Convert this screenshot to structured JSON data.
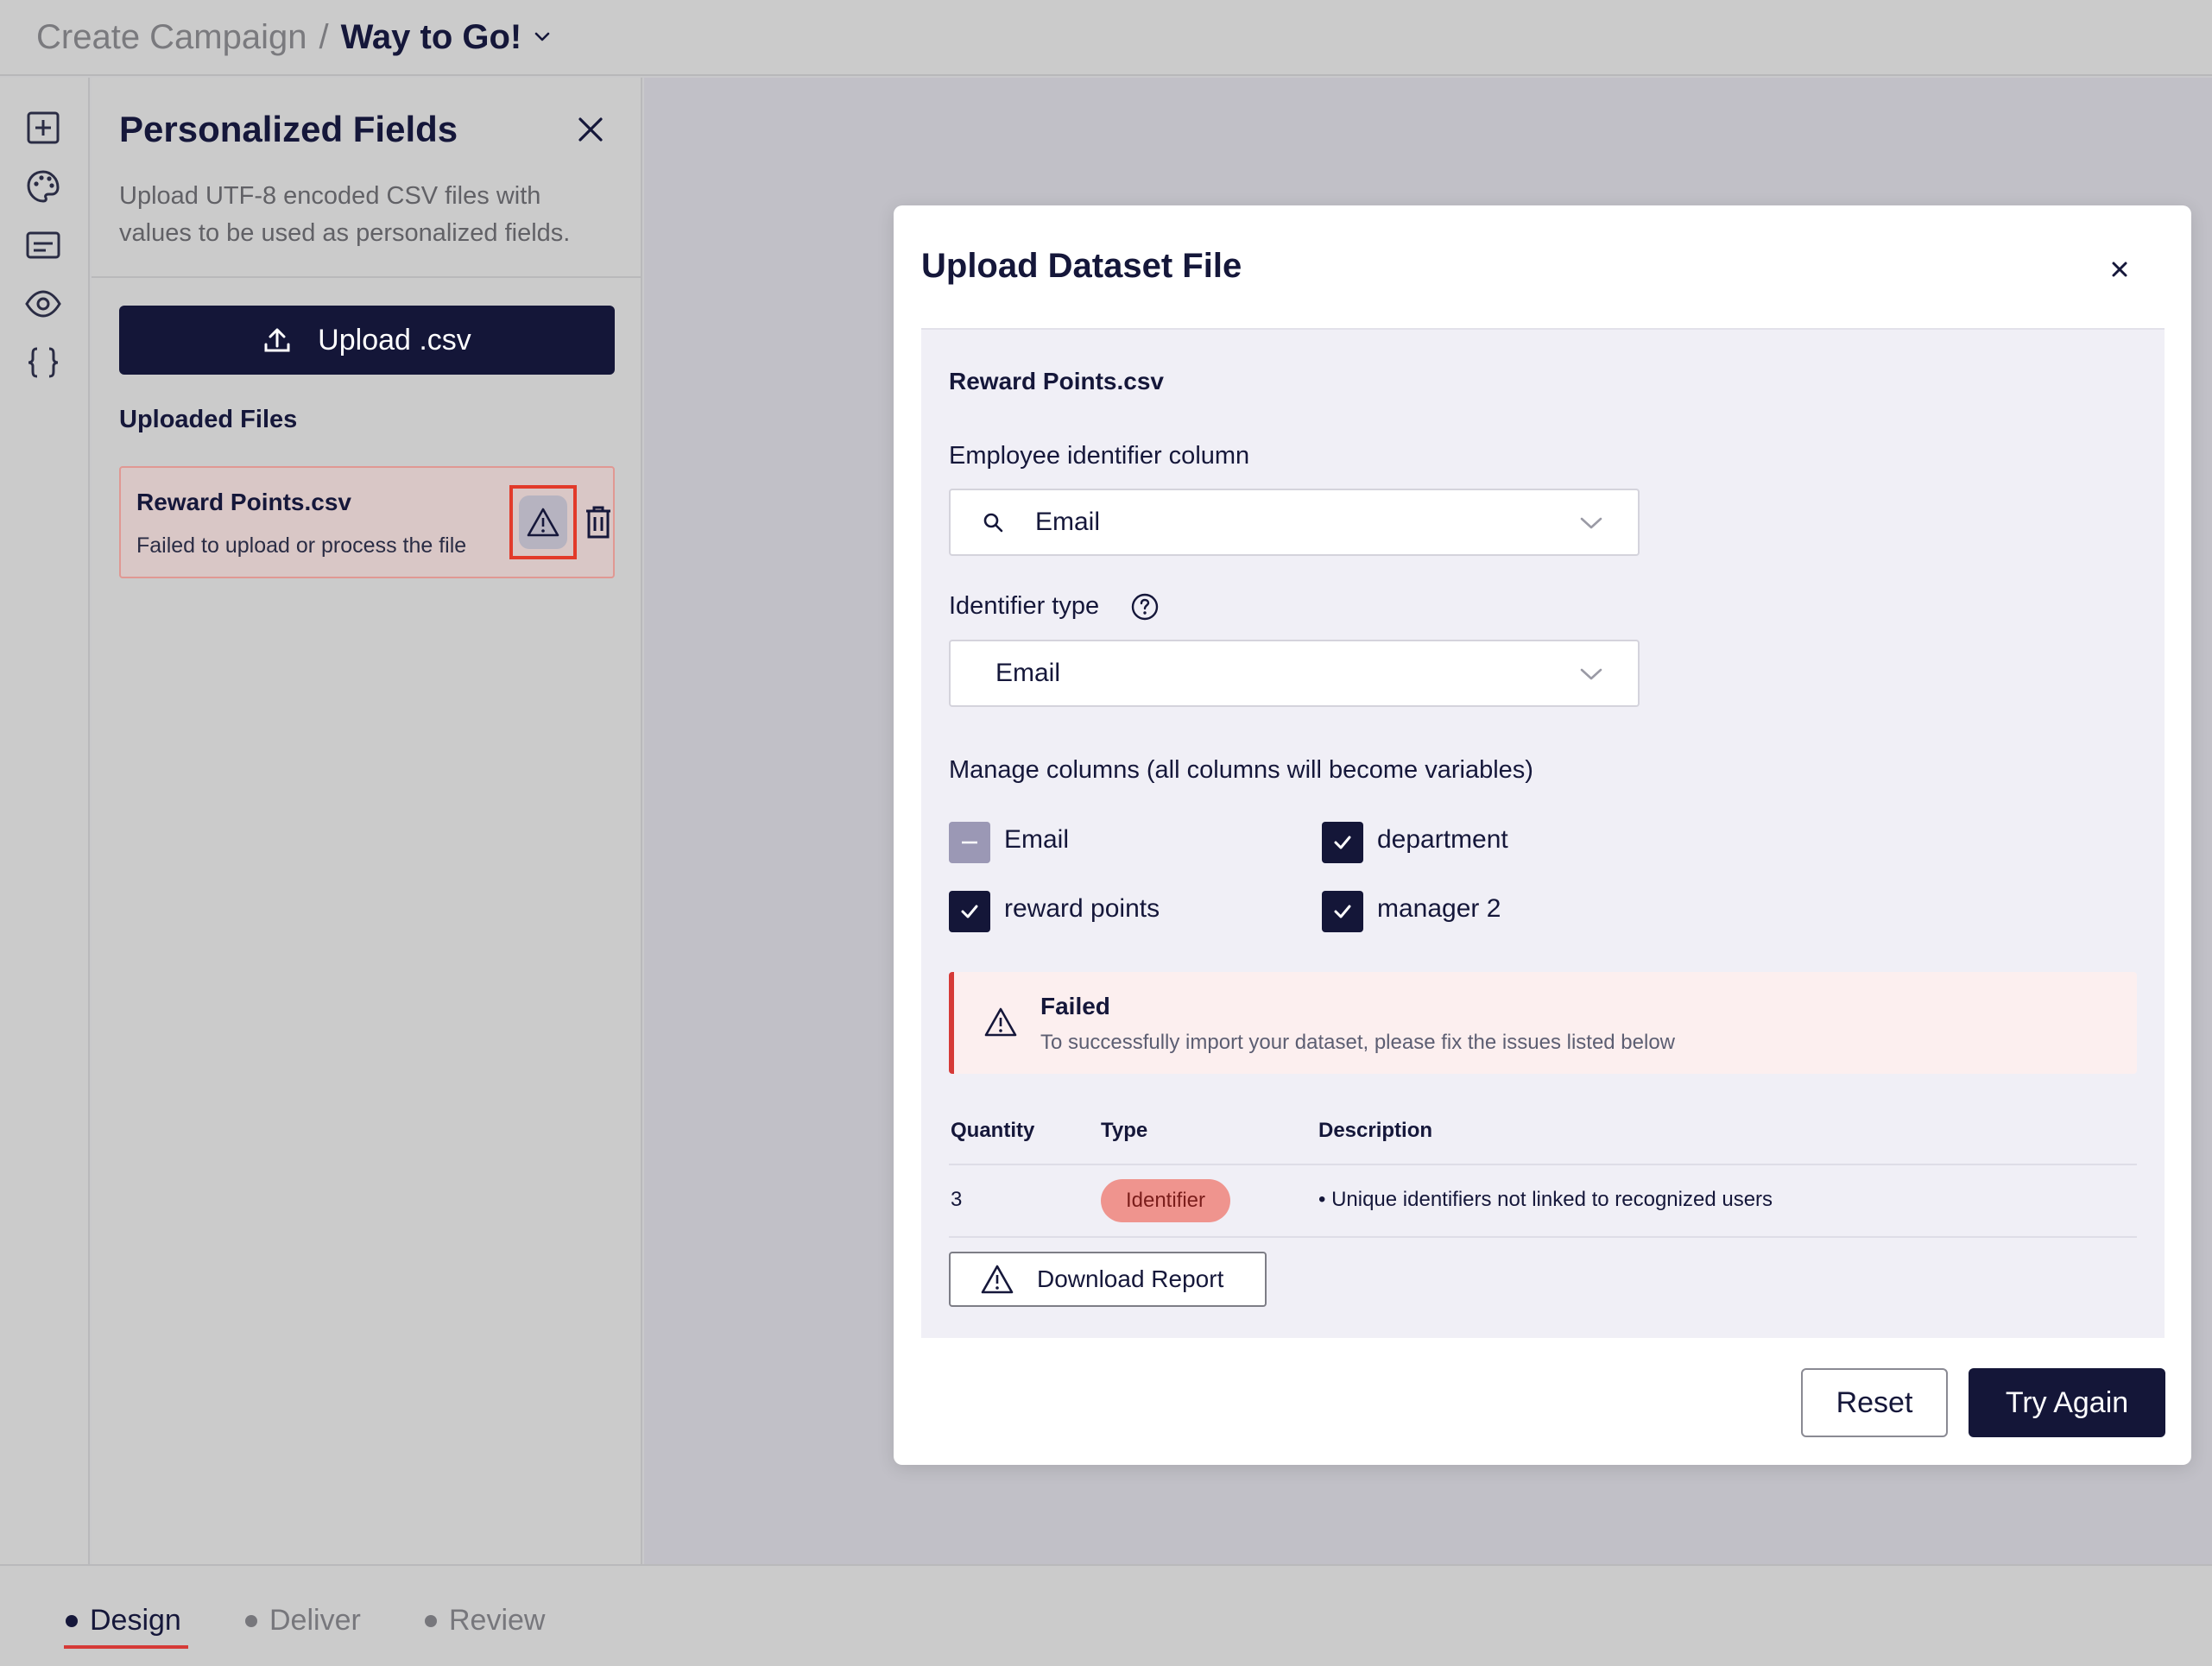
{
  "header": {
    "breadcrumb_root": "Create Campaign",
    "breadcrumb_sep": "/",
    "campaign_name": "Way to Go!"
  },
  "rail": {
    "icons": [
      "add-block-icon",
      "palette-icon",
      "text-block-icon",
      "preview-eye-icon",
      "code-braces-icon"
    ]
  },
  "panel": {
    "title": "Personalized Fields",
    "description": "Upload UTF-8 encoded CSV files with values to be used as personalized fields.",
    "upload_label": "Upload .csv",
    "uploaded_files_title": "Uploaded Files",
    "files": [
      {
        "name": "Reward Points.csv",
        "status": "Failed to upload or process the file"
      }
    ]
  },
  "modal": {
    "title": "Upload Dataset File",
    "file_name": "Reward Points.csv",
    "employee_identifier_label": "Employee identifier column",
    "employee_identifier_value": "Email",
    "identifier_type_label": "Identifier type",
    "identifier_type_value": "Email",
    "manage_columns_label": "Manage columns (all columns will become variables)",
    "columns": [
      {
        "label": "Email",
        "state": "partial"
      },
      {
        "label": "department",
        "state": "checked"
      },
      {
        "label": "reward points",
        "state": "checked"
      },
      {
        "label": "manager 2",
        "state": "checked"
      }
    ],
    "alert": {
      "title": "Failed",
      "message": "To successfully import your dataset, please fix the issues listed below",
      "color": "#d63a37"
    },
    "table": {
      "headers": [
        "Quantity",
        "Type",
        "Description"
      ],
      "rows": [
        {
          "quantity": "3",
          "type": "Identifier",
          "description": "• Unique identifiers not linked to recognized users"
        }
      ]
    },
    "download_label": "Download Report",
    "reset_label": "Reset",
    "try_again_label": "Try Again"
  },
  "bottom_tabs": [
    {
      "label": "Design",
      "active": true
    },
    {
      "label": "Deliver",
      "active": false
    },
    {
      "label": "Review",
      "active": false
    }
  ],
  "colors": {
    "primary": "#141638",
    "error": "#d63a37",
    "badge": "#ef948e"
  }
}
